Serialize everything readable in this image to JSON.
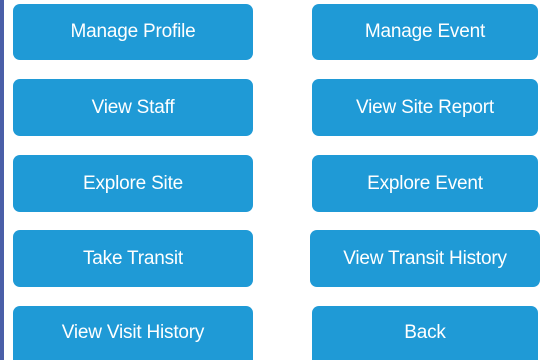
{
  "menu": {
    "manage_profile": "Manage Profile",
    "manage_event": "Manage Event",
    "view_staff": "View Staff",
    "view_site_report": "View Site Report",
    "explore_site": "Explore Site",
    "explore_event": "Explore Event",
    "take_transit": "Take Transit",
    "view_transit_history": "View Transit History",
    "view_visit_history": "View Visit History",
    "back": "Back"
  },
  "colors": {
    "button_bg": "#1f9ad6",
    "button_text": "#ffffff",
    "left_edge": "#4a5fa8",
    "background": "#ffffff"
  }
}
